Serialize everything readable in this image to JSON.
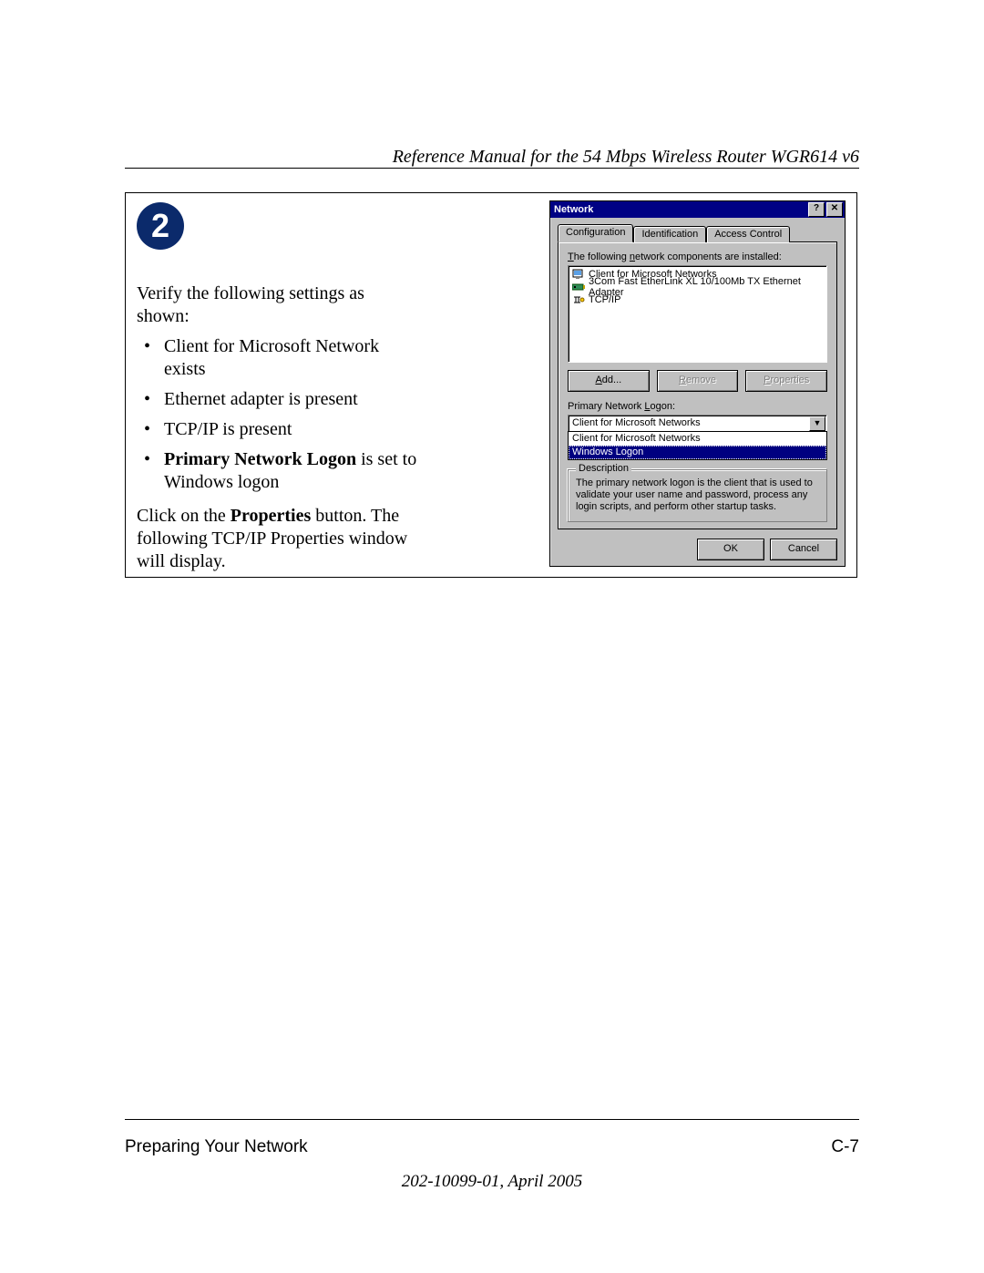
{
  "doc": {
    "header": "Reference Manual for the 54 Mbps Wireless Router WGR614 v6",
    "footer_left": "Preparing Your Network",
    "footer_right": "C-7",
    "footer_date": "202-10099-01, April 2005"
  },
  "step": {
    "number": "2",
    "intro": "Verify the following settings as shown:",
    "bullets": {
      "b0": "Client for Microsoft Network exists",
      "b1": "Ethernet adapter is present",
      "b2": "TCP/IP is present",
      "b3_bold": "Primary Network Logon",
      "b3_rest": " is set to Windows logon"
    },
    "outro_prefix": "Click on the ",
    "outro_bold": "Properties",
    "outro_suffix": " button. The following TCP/IP Properties window will display."
  },
  "dlg": {
    "title": "Network",
    "help_btn": "?",
    "close_btn": "✕",
    "tabs": {
      "t0": "Configuration",
      "t1": "Identification",
      "t2": "Access Control"
    },
    "components_label": "The following network components are installed:",
    "components": {
      "c0": "Client for Microsoft Networks",
      "c1": "3Com Fast EtherLink XL 10/100Mb TX Ethernet Adapter",
      "c2": "TCP/IP"
    },
    "buttons": {
      "add_u": "A",
      "add_rest": "dd...",
      "remove_u": "R",
      "remove_rest": "emove",
      "properties_u": "P",
      "properties_rest": "roperties"
    },
    "pnl_label": "Primary Network Logon:",
    "pnl_value": "Client for Microsoft Networks",
    "pnl_options": {
      "o0": "Client for Microsoft Networks",
      "o1": "Windows Logon"
    },
    "desc_title": "Description",
    "desc_body": "The primary network logon is the client that is used to validate your user name and password, process any login scripts, and perform other startup tasks.",
    "footer": {
      "ok": "OK",
      "cancel": "Cancel"
    }
  }
}
